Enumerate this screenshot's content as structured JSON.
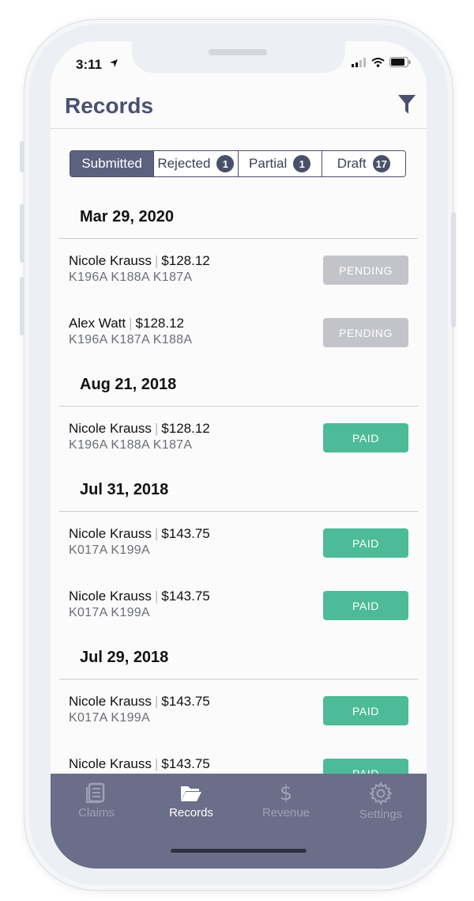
{
  "status_bar": {
    "time": "3:11"
  },
  "header": {
    "title": "Records"
  },
  "segments": [
    {
      "label": "Submitted",
      "count": ""
    },
    {
      "label": "Rejected",
      "count": "1"
    },
    {
      "label": "Partial",
      "count": "1"
    },
    {
      "label": "Draft",
      "count": "17"
    }
  ],
  "groups": [
    {
      "date": "Mar 29, 2020",
      "records": [
        {
          "name": "Nicole Krauss",
          "amount": "$128.12",
          "codes": "K196A K188A K187A",
          "status": "PENDING"
        },
        {
          "name": "Alex Watt",
          "amount": "$128.12",
          "codes": "K196A K187A K188A",
          "status": "PENDING"
        }
      ]
    },
    {
      "date": "Aug 21, 2018",
      "records": [
        {
          "name": "Nicole Krauss",
          "amount": "$128.12",
          "codes": "K196A K188A K187A",
          "status": "PAID"
        }
      ]
    },
    {
      "date": "Jul 31, 2018",
      "records": [
        {
          "name": "Nicole Krauss",
          "amount": "$143.75",
          "codes": "K017A K199A",
          "status": "PAID"
        },
        {
          "name": "Nicole Krauss",
          "amount": "$143.75",
          "codes": "K017A K199A",
          "status": "PAID"
        }
      ]
    },
    {
      "date": "Jul 29, 2018",
      "records": [
        {
          "name": "Nicole Krauss",
          "amount": "$143.75",
          "codes": "K017A K199A",
          "status": "PAID"
        },
        {
          "name": "Nicole Krauss",
          "amount": "$143.75",
          "codes": "",
          "status": "PAID"
        }
      ]
    }
  ],
  "tabs": [
    {
      "label": "Claims",
      "icon": "document-icon"
    },
    {
      "label": "Records",
      "icon": "folder-icon"
    },
    {
      "label": "Revenue",
      "icon": "dollar-icon"
    },
    {
      "label": "Settings",
      "icon": "gear-icon"
    }
  ],
  "colors": {
    "accent": "#5c6180",
    "paid": "#4dbb97",
    "pending": "#c3c4c9",
    "tabbar": "#6b6e88"
  }
}
